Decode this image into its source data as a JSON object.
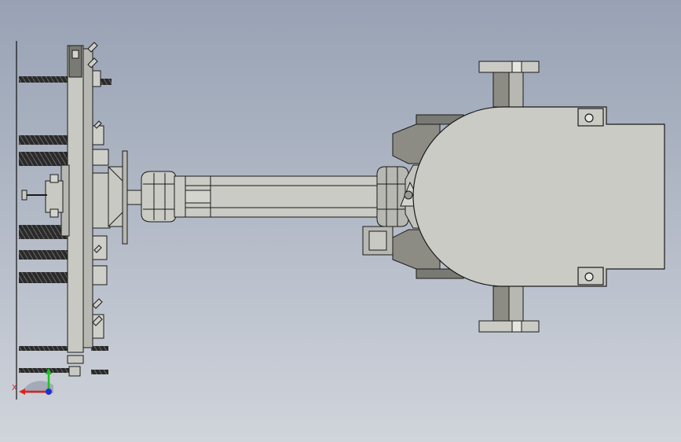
{
  "viewport": {
    "background_top": "#98a2b4",
    "background_bottom": "#d0d4db"
  },
  "model": {
    "fill_color": "#cbcbc5",
    "dark_fill_color": "#8c8c84",
    "edge_color": "#1a1a1a"
  },
  "triad": {
    "x_label": "X",
    "x_color": "#e02020",
    "y_color": "#20c020",
    "z_color": "#2030d0"
  }
}
